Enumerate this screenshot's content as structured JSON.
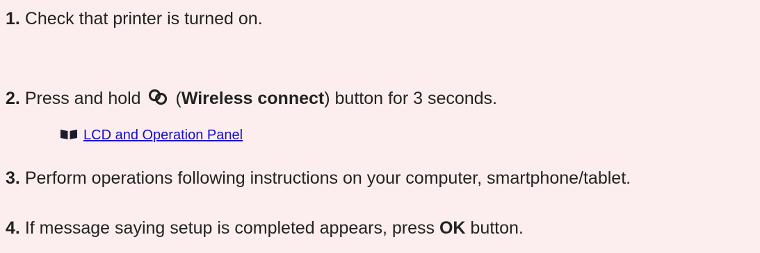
{
  "steps": [
    {
      "number": "1.",
      "text": "Check that printer is turned on."
    },
    {
      "number": "2.",
      "text_before": "Press and hold",
      "icon": "wireless-connect-icon",
      "paren_open": " (",
      "bold": "Wireless connect",
      "text_after": ") button for 3 seconds.",
      "link": {
        "icon": "book-icon",
        "label": "LCD and Operation Panel"
      }
    },
    {
      "number": "3.",
      "text": "Perform operations following instructions on your computer, smartphone/tablet."
    },
    {
      "number": "4.",
      "text_before": "If message saying setup is completed appears, press",
      "bold": "OK",
      "text_after": "button."
    }
  ],
  "colors": {
    "background": "#fceeee",
    "text": "#222222",
    "link": "#1a0dcc",
    "link_icon": "#1c1c2e"
  }
}
